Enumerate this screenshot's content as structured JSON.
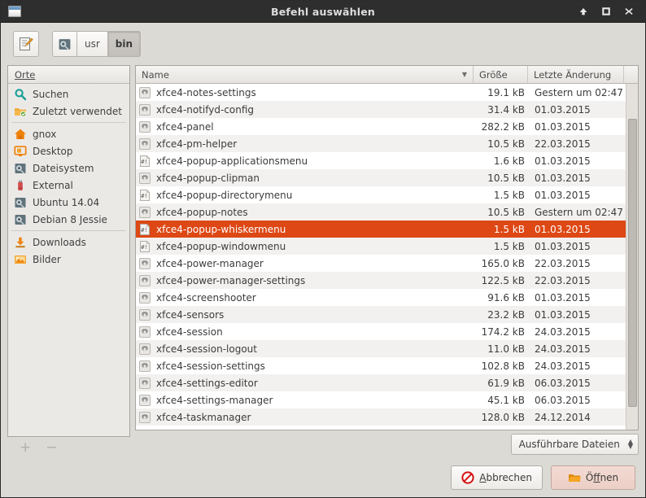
{
  "window": {
    "title": "Befehl auswählen",
    "icon": "window-icon",
    "buttons": [
      {
        "name": "shade-button",
        "glyph": "shade-arrow-icon"
      },
      {
        "name": "maximize-button",
        "glyph": "maximize-square-icon"
      },
      {
        "name": "close-button",
        "glyph": "close-x-icon"
      }
    ]
  },
  "toolbar": {
    "edit_button": {
      "name": "edit-location-button",
      "icon": "pencil-note-icon"
    },
    "path": [
      {
        "label": "",
        "icon": "filesystem-drive-icon",
        "active": false
      },
      {
        "label": "usr",
        "icon": "",
        "active": false
      },
      {
        "label": "bin",
        "icon": "",
        "active": true
      }
    ]
  },
  "sidebar": {
    "header": "Orte",
    "items": [
      {
        "label": "Suchen",
        "icon": "search-icon"
      },
      {
        "label": "Zuletzt verwendet",
        "icon": "recent-folder-icon"
      },
      {
        "separator_after": true
      },
      {
        "label": "gnox",
        "icon": "home-icon"
      },
      {
        "label": "Desktop",
        "icon": "desktop-icon"
      },
      {
        "label": "Dateisystem",
        "icon": "filesystem-drive-icon"
      },
      {
        "label": "External",
        "icon": "usb-stick-icon"
      },
      {
        "label": "Ubuntu 14.04",
        "icon": "filesystem-drive-icon"
      },
      {
        "label": "Debian 8 Jessie",
        "icon": "filesystem-drive-icon"
      },
      {
        "separator_after": true
      },
      {
        "label": "Downloads",
        "icon": "downloads-icon"
      },
      {
        "label": "Bilder",
        "icon": "pictures-icon"
      }
    ],
    "add_button": "+",
    "remove_button": "−"
  },
  "filelist": {
    "columns": [
      {
        "key": "name",
        "label": "Name",
        "sorted": true,
        "sort_arrow": "▼"
      },
      {
        "key": "size",
        "label": "Größe"
      },
      {
        "key": "date",
        "label": "Letzte Änderung"
      }
    ],
    "rows": [
      {
        "icon": "binary-gear-icon",
        "name": "xfce4-notes-settings",
        "size": "19.1 kB",
        "date": "Gestern um 02:47",
        "selected": false
      },
      {
        "icon": "binary-gear-icon",
        "name": "xfce4-notifyd-config",
        "size": "31.4 kB",
        "date": "01.03.2015",
        "selected": false
      },
      {
        "icon": "binary-gear-icon",
        "name": "xfce4-panel",
        "size": "282.2 kB",
        "date": "01.03.2015",
        "selected": false
      },
      {
        "icon": "binary-gear-icon",
        "name": "xfce4-pm-helper",
        "size": "10.5 kB",
        "date": "22.03.2015",
        "selected": false
      },
      {
        "icon": "script-shebang-icon",
        "name": "xfce4-popup-applicationsmenu",
        "size": "1.6 kB",
        "date": "01.03.2015",
        "selected": false
      },
      {
        "icon": "binary-gear-icon",
        "name": "xfce4-popup-clipman",
        "size": "10.5 kB",
        "date": "01.03.2015",
        "selected": false
      },
      {
        "icon": "script-shebang-icon",
        "name": "xfce4-popup-directorymenu",
        "size": "1.5 kB",
        "date": "01.03.2015",
        "selected": false
      },
      {
        "icon": "binary-gear-icon",
        "name": "xfce4-popup-notes",
        "size": "10.5 kB",
        "date": "Gestern um 02:47",
        "selected": false
      },
      {
        "icon": "script-shebang-icon",
        "name": "xfce4-popup-whiskermenu",
        "size": "1.5 kB",
        "date": "01.03.2015",
        "selected": true
      },
      {
        "icon": "script-shebang-icon",
        "name": "xfce4-popup-windowmenu",
        "size": "1.5 kB",
        "date": "01.03.2015",
        "selected": false
      },
      {
        "icon": "binary-gear-icon",
        "name": "xfce4-power-manager",
        "size": "165.0 kB",
        "date": "22.03.2015",
        "selected": false
      },
      {
        "icon": "binary-gear-icon",
        "name": "xfce4-power-manager-settings",
        "size": "122.5 kB",
        "date": "22.03.2015",
        "selected": false
      },
      {
        "icon": "binary-gear-icon",
        "name": "xfce4-screenshooter",
        "size": "91.6 kB",
        "date": "01.03.2015",
        "selected": false
      },
      {
        "icon": "binary-gear-icon",
        "name": "xfce4-sensors",
        "size": "23.2 kB",
        "date": "01.03.2015",
        "selected": false
      },
      {
        "icon": "binary-gear-icon",
        "name": "xfce4-session",
        "size": "174.2 kB",
        "date": "24.03.2015",
        "selected": false
      },
      {
        "icon": "binary-gear-icon",
        "name": "xfce4-session-logout",
        "size": "11.0 kB",
        "date": "24.03.2015",
        "selected": false
      },
      {
        "icon": "binary-gear-icon",
        "name": "xfce4-session-settings",
        "size": "102.8 kB",
        "date": "24.03.2015",
        "selected": false
      },
      {
        "icon": "binary-gear-icon",
        "name": "xfce4-settings-editor",
        "size": "61.9 kB",
        "date": "06.03.2015",
        "selected": false
      },
      {
        "icon": "binary-gear-icon",
        "name": "xfce4-settings-manager",
        "size": "45.1 kB",
        "date": "06.03.2015",
        "selected": false
      },
      {
        "icon": "binary-gear-icon",
        "name": "xfce4-taskmanager",
        "size": "128.0 kB",
        "date": "24.12.2014",
        "selected": false
      }
    ]
  },
  "filter": {
    "selected": "Ausführbare Dateien"
  },
  "footer": {
    "cancel": {
      "label": "Abbrechen",
      "mnemonic": "A",
      "icon": "no-entry-icon"
    },
    "open": {
      "label": "Öffnen",
      "mnemonic": "ff",
      "icon": "open-folder-icon"
    }
  },
  "colors": {
    "selection": "#dd4814",
    "titlebar": "#2e2e2e",
    "window_bg": "#dcdad5",
    "accent_orange": "#f0820a"
  }
}
